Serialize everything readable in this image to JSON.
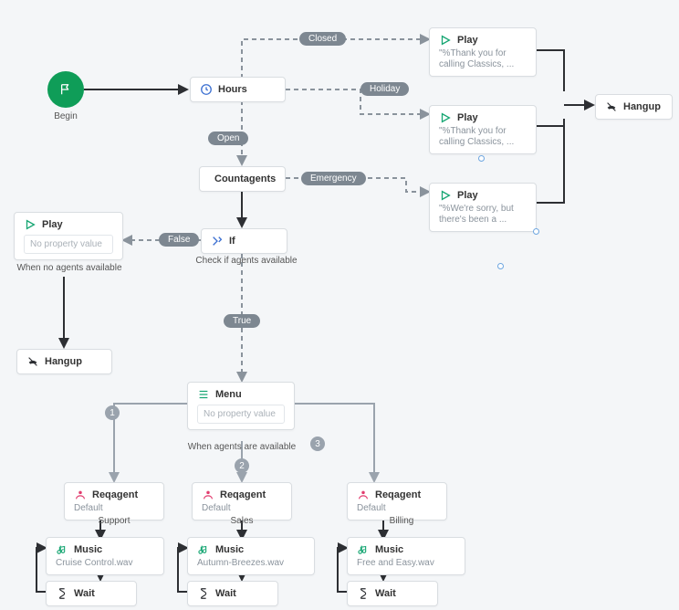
{
  "begin": {
    "label": "Begin"
  },
  "hours": {
    "title": "Hours"
  },
  "countagents": {
    "title": "Countagents"
  },
  "ifnode": {
    "title": "If",
    "caption": "Check if agents available"
  },
  "playNoAgents": {
    "title": "Play",
    "placeholder": "No property value",
    "caption": "When no agents available"
  },
  "hangup1": {
    "title": "Hangup"
  },
  "menu": {
    "title": "Menu",
    "placeholder": "No property value",
    "caption": "When agents are available"
  },
  "reqSupport": {
    "title": "Reqagent",
    "sub": "Default",
    "caption": "Support"
  },
  "reqSales": {
    "title": "Reqagent",
    "sub": "Default",
    "caption": "Sales"
  },
  "reqBilling": {
    "title": "Reqagent",
    "sub": "Default",
    "caption": "Billing"
  },
  "musicSupport": {
    "title": "Music",
    "sub": "Cruise Control.wav"
  },
  "musicSales": {
    "title": "Music",
    "sub": "Autumn-Breezes.wav"
  },
  "musicBilling": {
    "title": "Music",
    "sub": "Free and Easy.wav"
  },
  "waitSupport": {
    "title": "Wait"
  },
  "waitSales": {
    "title": "Wait"
  },
  "waitBilling": {
    "title": "Wait"
  },
  "playClosed": {
    "title": "Play",
    "sub": "\"%Thank you for calling Classics, ..."
  },
  "playHoliday": {
    "title": "Play",
    "sub": "\"%Thank you for calling Classics, ..."
  },
  "playEmergency": {
    "title": "Play",
    "sub": "\"%We're sorry, but there's been a ..."
  },
  "hangup2": {
    "title": "Hangup"
  },
  "pills": {
    "closed": "Closed",
    "open": "Open",
    "holiday": "Holiday",
    "emergency": "Emergency",
    "false": "False",
    "true": "True"
  },
  "nums": {
    "one": "1",
    "two": "2",
    "three": "3"
  }
}
